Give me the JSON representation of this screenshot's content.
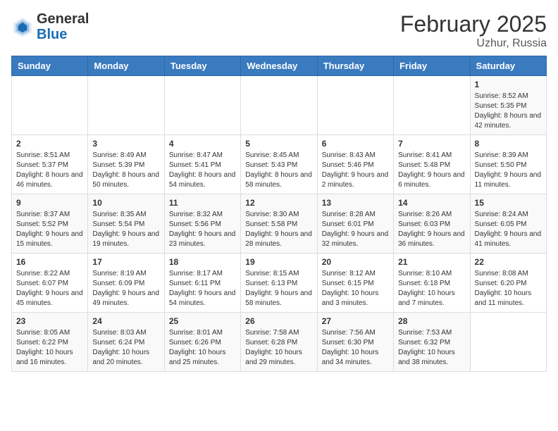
{
  "header": {
    "logo_general": "General",
    "logo_blue": "Blue",
    "month_title": "February 2025",
    "location": "Uzhur, Russia"
  },
  "weekdays": [
    "Sunday",
    "Monday",
    "Tuesday",
    "Wednesday",
    "Thursday",
    "Friday",
    "Saturday"
  ],
  "weeks": [
    [
      {
        "day": "",
        "detail": ""
      },
      {
        "day": "",
        "detail": ""
      },
      {
        "day": "",
        "detail": ""
      },
      {
        "day": "",
        "detail": ""
      },
      {
        "day": "",
        "detail": ""
      },
      {
        "day": "",
        "detail": ""
      },
      {
        "day": "1",
        "detail": "Sunrise: 8:52 AM\nSunset: 5:35 PM\nDaylight: 8 hours and 42 minutes."
      }
    ],
    [
      {
        "day": "2",
        "detail": "Sunrise: 8:51 AM\nSunset: 5:37 PM\nDaylight: 8 hours and 46 minutes."
      },
      {
        "day": "3",
        "detail": "Sunrise: 8:49 AM\nSunset: 5:39 PM\nDaylight: 8 hours and 50 minutes."
      },
      {
        "day": "4",
        "detail": "Sunrise: 8:47 AM\nSunset: 5:41 PM\nDaylight: 8 hours and 54 minutes."
      },
      {
        "day": "5",
        "detail": "Sunrise: 8:45 AM\nSunset: 5:43 PM\nDaylight: 8 hours and 58 minutes."
      },
      {
        "day": "6",
        "detail": "Sunrise: 8:43 AM\nSunset: 5:46 PM\nDaylight: 9 hours and 2 minutes."
      },
      {
        "day": "7",
        "detail": "Sunrise: 8:41 AM\nSunset: 5:48 PM\nDaylight: 9 hours and 6 minutes."
      },
      {
        "day": "8",
        "detail": "Sunrise: 8:39 AM\nSunset: 5:50 PM\nDaylight: 9 hours and 11 minutes."
      }
    ],
    [
      {
        "day": "9",
        "detail": "Sunrise: 8:37 AM\nSunset: 5:52 PM\nDaylight: 9 hours and 15 minutes."
      },
      {
        "day": "10",
        "detail": "Sunrise: 8:35 AM\nSunset: 5:54 PM\nDaylight: 9 hours and 19 minutes."
      },
      {
        "day": "11",
        "detail": "Sunrise: 8:32 AM\nSunset: 5:56 PM\nDaylight: 9 hours and 23 minutes."
      },
      {
        "day": "12",
        "detail": "Sunrise: 8:30 AM\nSunset: 5:58 PM\nDaylight: 9 hours and 28 minutes."
      },
      {
        "day": "13",
        "detail": "Sunrise: 8:28 AM\nSunset: 6:01 PM\nDaylight: 9 hours and 32 minutes."
      },
      {
        "day": "14",
        "detail": "Sunrise: 8:26 AM\nSunset: 6:03 PM\nDaylight: 9 hours and 36 minutes."
      },
      {
        "day": "15",
        "detail": "Sunrise: 8:24 AM\nSunset: 6:05 PM\nDaylight: 9 hours and 41 minutes."
      }
    ],
    [
      {
        "day": "16",
        "detail": "Sunrise: 8:22 AM\nSunset: 6:07 PM\nDaylight: 9 hours and 45 minutes."
      },
      {
        "day": "17",
        "detail": "Sunrise: 8:19 AM\nSunset: 6:09 PM\nDaylight: 9 hours and 49 minutes."
      },
      {
        "day": "18",
        "detail": "Sunrise: 8:17 AM\nSunset: 6:11 PM\nDaylight: 9 hours and 54 minutes."
      },
      {
        "day": "19",
        "detail": "Sunrise: 8:15 AM\nSunset: 6:13 PM\nDaylight: 9 hours and 58 minutes."
      },
      {
        "day": "20",
        "detail": "Sunrise: 8:12 AM\nSunset: 6:15 PM\nDaylight: 10 hours and 3 minutes."
      },
      {
        "day": "21",
        "detail": "Sunrise: 8:10 AM\nSunset: 6:18 PM\nDaylight: 10 hours and 7 minutes."
      },
      {
        "day": "22",
        "detail": "Sunrise: 8:08 AM\nSunset: 6:20 PM\nDaylight: 10 hours and 11 minutes."
      }
    ],
    [
      {
        "day": "23",
        "detail": "Sunrise: 8:05 AM\nSunset: 6:22 PM\nDaylight: 10 hours and 16 minutes."
      },
      {
        "day": "24",
        "detail": "Sunrise: 8:03 AM\nSunset: 6:24 PM\nDaylight: 10 hours and 20 minutes."
      },
      {
        "day": "25",
        "detail": "Sunrise: 8:01 AM\nSunset: 6:26 PM\nDaylight: 10 hours and 25 minutes."
      },
      {
        "day": "26",
        "detail": "Sunrise: 7:58 AM\nSunset: 6:28 PM\nDaylight: 10 hours and 29 minutes."
      },
      {
        "day": "27",
        "detail": "Sunrise: 7:56 AM\nSunset: 6:30 PM\nDaylight: 10 hours and 34 minutes."
      },
      {
        "day": "28",
        "detail": "Sunrise: 7:53 AM\nSunset: 6:32 PM\nDaylight: 10 hours and 38 minutes."
      },
      {
        "day": "",
        "detail": ""
      }
    ]
  ]
}
